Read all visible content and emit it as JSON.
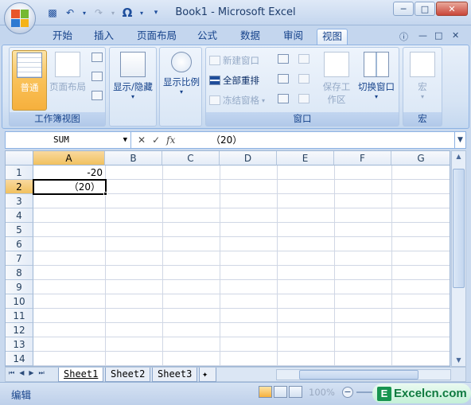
{
  "window": {
    "title": "Book1 - Microsoft Excel"
  },
  "tabs": [
    "开始",
    "插入",
    "页面布局",
    "公式",
    "数据",
    "审阅",
    "视图"
  ],
  "active_tab": "视图",
  "ribbon": {
    "groups": {
      "workbook_views": {
        "label": "工作簿视图",
        "normal": "普通",
        "page_layout": "页面布局"
      },
      "show_hide": {
        "label": "显示/隐藏"
      },
      "zoom": {
        "label": "显示比例"
      },
      "window": {
        "label": "窗口",
        "new_window": "新建窗口",
        "arrange_all": "全部重排",
        "freeze_panes": "冻结窗格",
        "save_workspace": "保存工作区",
        "switch_windows": "切换窗口"
      },
      "macros": {
        "label": "宏",
        "macros": "宏"
      }
    }
  },
  "formula_bar": {
    "name_box": "SUM",
    "formula": "（20）"
  },
  "columns": [
    "A",
    "B",
    "C",
    "D",
    "E",
    "F",
    "G"
  ],
  "rows": [
    "1",
    "2",
    "3",
    "4",
    "5",
    "6",
    "7",
    "8",
    "9",
    "10",
    "11",
    "12",
    "13",
    "14"
  ],
  "cells": {
    "A1": "-20",
    "A2": "（20）"
  },
  "sheets": [
    "Sheet1",
    "Sheet2",
    "Sheet3"
  ],
  "active_sheet": "Sheet1",
  "status": {
    "mode": "编辑",
    "zoom": "100%"
  },
  "watermark": {
    "text": "Excelcn.com"
  },
  "colors": {
    "accent": "#f6b03d",
    "ribbon": "#d5e3f4",
    "text": "#15428b"
  }
}
